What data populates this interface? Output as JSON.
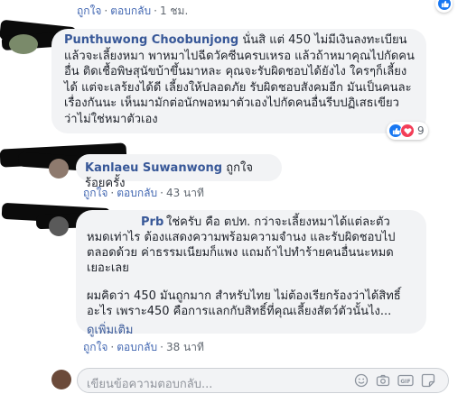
{
  "top": {
    "like": "ถูกใจ",
    "reply": "ตอบกลับ",
    "time": "1 ชม."
  },
  "comment1": {
    "author": "Punthuwong Choobunjong",
    "text": "นั่นสิ แต่ 450 ไม่มีเงินลงทะเบียน แล้วจะเลี้ยงหมา พาหมาไปฉีดวัคซีนครบเหรอ แล้วถ้าหมาคุณไปกัดคนอื่น ติดเชื้อพิษสุนัขบ้าขึ้นมาหละ คุณจะรับผิดชอบได้ยังไง ใครๆก็เลี้ยงได้ แต่จะเลร้ยงได้ดี เลี้ยงให้ปลอดภัย รับผิดชอบสังคมอีก มันเป็นคนละเรื่องกันนะ เห็นมามักต่อนักพอหมาตัวเองไปกัดคนอื่นรีบปฏิเสธเขียว ว่าไม่ใช่หมาตัวเอง",
    "reaction_count": "9"
  },
  "comment2": {
    "author": "Kanlaeu Suwanwong",
    "text": "ถูกใจร้อยครั้ง",
    "like": "ถูกใจ",
    "reply": "ตอบกลับ",
    "time": "43 นาที"
  },
  "comment3": {
    "author": "Prb",
    "para1": "ใช่ครับ คือ ตปท. กว่าจะเลี้ยงหมาได้แต่ละตัว หมดเท่าไร ต้องแสดงความพร้อมความจำนง และรับผิดชอบไปตลอดด้วย ค่าธรรมเนียมก็แพง แถมถ้าไปทำร้ายคนอื่นนะหมดเยอะเลย",
    "para2": "ผมคิดว่า 450 มันถูกมาก สำหรับไทย ไม่ต้องเรียกร้องว่าได้สิทธิ์อะไร เพราะ450 คือการแลกกับสิทธิ์ที่คุณเลี้ยงสัตว์ตัวนั้นไง...",
    "see_more": "ดูเพิ่มเติม",
    "like": "ถูกใจ",
    "reply": "ตอบกลับ",
    "time": "38 นาที"
  },
  "reply_box": {
    "placeholder": "เขียนข้อความตอบกลับ..."
  },
  "colors": {
    "link": "#385898",
    "bubble": "#f2f3f5",
    "like_blue": "#1877f2",
    "love_red": "#f33e58"
  }
}
